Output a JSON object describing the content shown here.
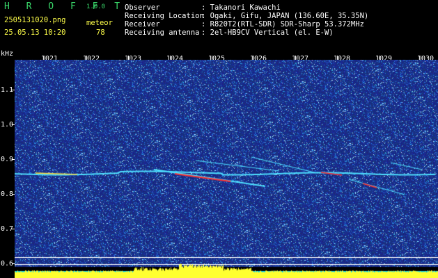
{
  "header": {
    "brand": "H R O F F T",
    "version": "1.0.0",
    "filename": "2505131020.png",
    "datetime": "25.05.13 10:20",
    "meteor_label": "meteor",
    "meteor_count": "78",
    "fields": [
      {
        "label": "Observer",
        "value": ": Takanori Kawachi"
      },
      {
        "label": "Receiving Location",
        "value": ": Ogaki, Gifu, JAPAN (136.60E, 35.35N)"
      },
      {
        "label": "Receiver",
        "value": ": R820T2(RTL-SDR) SDR-Sharp 53.372MHz"
      },
      {
        "label": "Receiving antenna",
        "value": ": 2el-HB9CV Vertical (el. E-W)"
      }
    ]
  },
  "axes": {
    "y_unit": "kHz",
    "x_ticks": [
      "1021",
      "1022",
      "1023",
      "1024",
      "1025",
      "1026",
      "1027",
      "1028",
      "1029",
      "1030"
    ],
    "y_ticks": [
      "1.1",
      "1.0",
      "0.9",
      "0.8",
      "0.7",
      "0.6"
    ]
  },
  "colors": {
    "background_noise": "#1a2a8a",
    "signal_cyan": "#4ee0ff",
    "signal_hot": "#ff3030",
    "spectrum_fill": "#ffff30",
    "bottom_band": "#00d8ff"
  }
}
